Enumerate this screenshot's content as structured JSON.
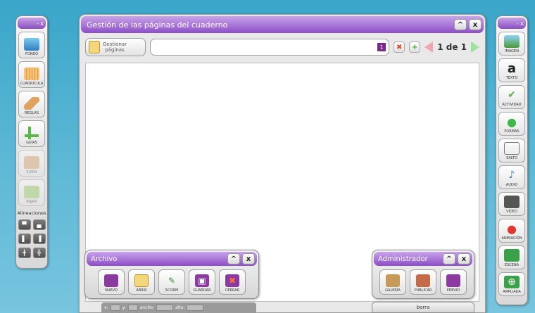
{
  "main_window": {
    "title": "Gestión de las páginas del cuaderno",
    "manage_button_label": "Gestionar\npáginas",
    "current_page_badge": "1",
    "page_counter": "1 de 1"
  },
  "left_toolbar": {
    "items": [
      {
        "label": "FONDO",
        "icon": "background-icon"
      },
      {
        "label": "CUADRICULA",
        "icon": "grid-icon"
      },
      {
        "label": "REGLAS",
        "icon": "ruler-icon"
      },
      {
        "label": "GUÍAS",
        "icon": "guides-icon"
      },
      {
        "label": "SUBIR",
        "icon": "move-up-icon"
      },
      {
        "label": "BAJAR",
        "icon": "move-down-icon"
      }
    ],
    "alignments_label": "Alineaciones"
  },
  "right_toolbar": {
    "items": [
      {
        "label": "IMAGEN",
        "icon": "image-icon"
      },
      {
        "label": "TEXTO",
        "icon": "text-icon",
        "glyph": "a"
      },
      {
        "label": "ACTIVIDAD",
        "icon": "activity-icon"
      },
      {
        "label": "FORMAS",
        "icon": "shapes-icon"
      },
      {
        "label": "SALTO",
        "icon": "jump-icon"
      },
      {
        "label": "AUDIO",
        "icon": "audio-icon"
      },
      {
        "label": "VÍDEO",
        "icon": "video-icon"
      },
      {
        "label": "ANIMACIÓN",
        "icon": "animation-icon"
      },
      {
        "label": "ESCENA",
        "icon": "scene-icon"
      },
      {
        "label": "AMPLIADA",
        "icon": "zoom-icon"
      }
    ]
  },
  "archivo_panel": {
    "title": "Archivo",
    "buttons": [
      {
        "label": "NUEVO",
        "icon": "new-icon"
      },
      {
        "label": "ABRIR",
        "icon": "open-icon"
      },
      {
        "label": "SCORM",
        "icon": "scorm-icon"
      },
      {
        "label": "GUARDAR",
        "icon": "save-icon"
      },
      {
        "label": "CERRAR",
        "icon": "close-file-icon"
      }
    ]
  },
  "admin_panel": {
    "title": "Administrador",
    "buttons": [
      {
        "label": "GALERÍA",
        "icon": "gallery-icon"
      },
      {
        "label": "PUBLICAR",
        "icon": "publish-icon"
      },
      {
        "label": "PREVIO",
        "icon": "preview-icon"
      }
    ]
  },
  "bottom_bar": {
    "x_label": "x:",
    "y_label": "y:",
    "width_label": "ancho:",
    "height_label": "alto:",
    "borra_label": "borra"
  },
  "colors": {
    "background": "#4fb1d2",
    "titlebar_purple": "#8c4ec6",
    "page_badge": "#7a2a8c"
  }
}
